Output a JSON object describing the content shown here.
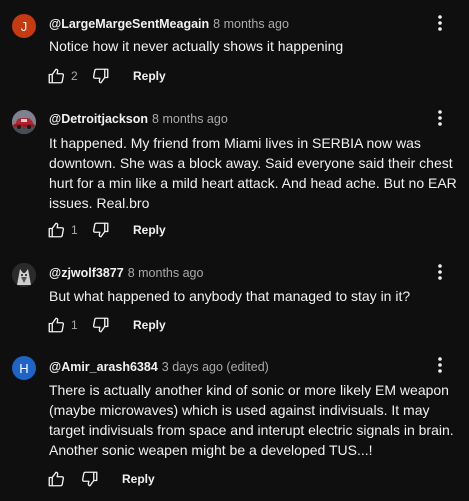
{
  "comments": [
    {
      "avatar_initial": "J",
      "avatar_color": "#c53a11",
      "author": "@LargeMargeSentMeagain",
      "time": "8 months ago",
      "text": "Notice how it never actually shows it happening",
      "likes": "2",
      "reply_label": "Reply"
    },
    {
      "avatar_initial": "",
      "avatar_color": "#6b6f7a",
      "author": "@Detroitjackson",
      "time": "8 months ago",
      "text": "It happened. My friend from Miami lives in SERBIA now was downtown. She was a block away. Said everyone said their chest hurt for a min like a mild heart attack. And head ache. But no EAR issues. Real.bro",
      "likes": "1",
      "reply_label": "Reply"
    },
    {
      "avatar_initial": "",
      "avatar_color": "#3a3a3a",
      "author": "@zjwolf3877",
      "time": "8 months ago",
      "text": "But what happened to anybody that managed to stay in it?",
      "likes": "1",
      "reply_label": "Reply"
    },
    {
      "avatar_initial": "H",
      "avatar_color": "#1e63c6",
      "author": "@Amir_arash6384",
      "time": "3 days ago (edited)",
      "text": "There is actually another kind of sonic or more likely EM weapon (maybe microwaves) which is used against indivisuals. It may target indivisuals from space and interupt electric signals in brain. Another sonic weapen might be a developed TUS...!",
      "likes": "",
      "reply_label": "Reply"
    }
  ]
}
